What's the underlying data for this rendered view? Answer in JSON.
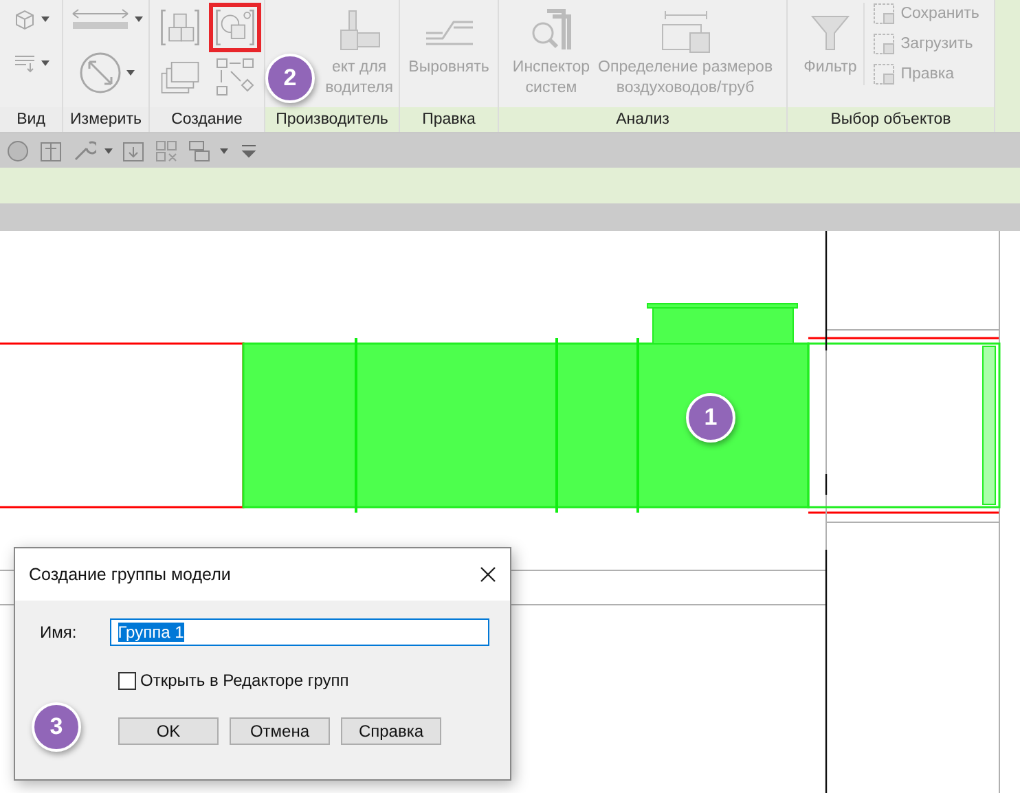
{
  "ribbon": {
    "panels": [
      {
        "label": "Вид",
        "kind": "standard",
        "buttons": [
          {
            "kind": "icon",
            "dropdown": true,
            "highlighted": false
          },
          {
            "kind": "icon",
            "dropdown": true,
            "highlighted": false
          }
        ]
      },
      {
        "label": "Измерить",
        "kind": "standard",
        "buttons": [
          {
            "kind": "icon",
            "dropdown": true,
            "highlighted": false
          },
          {
            "kind": "icon",
            "dropdown": true,
            "highlighted": false
          }
        ]
      },
      {
        "label": "Создание",
        "kind": "standard",
        "buttons": [
          {
            "kind": "icon",
            "dropdown": false,
            "highlighted": false
          },
          {
            "kind": "icon",
            "dropdown": false,
            "highlighted": true
          },
          {
            "kind": "icon",
            "dropdown": false,
            "highlighted": false
          },
          {
            "kind": "icon",
            "dropdown": false,
            "highlighted": false
          }
        ]
      },
      {
        "label": "Производитель",
        "kind": "contextual",
        "buttons": [
          {
            "kind": "large",
            "lines": [
              "ект для",
              "водителя"
            ],
            "disabled": true
          }
        ]
      },
      {
        "label": "Правка",
        "kind": "contextual",
        "buttons": [
          {
            "kind": "large",
            "lines": [
              "Выровнять"
            ],
            "disabled": true
          }
        ]
      },
      {
        "label": "Анализ",
        "kind": "contextual",
        "buttons": [
          {
            "kind": "large",
            "lines": [
              "Инспектор",
              "систем"
            ],
            "disabled": true
          },
          {
            "kind": "large",
            "lines": [
              "Определение размеров",
              "воздуховодов/труб"
            ],
            "disabled": true
          }
        ]
      },
      {
        "label": "Выбор объектов",
        "kind": "contextual",
        "buttons": [
          {
            "kind": "large",
            "lines": [
              "Фильтр"
            ],
            "disabled": true
          },
          {
            "kind": "small",
            "lines": [
              "Сохранить"
            ],
            "disabled": true
          },
          {
            "kind": "small",
            "lines": [
              "Загрузить"
            ],
            "disabled": true
          },
          {
            "kind": "small",
            "lines": [
              "Правка"
            ],
            "disabled": true
          }
        ]
      }
    ]
  },
  "badges": [
    {
      "number": "1"
    },
    {
      "number": "2"
    },
    {
      "number": "3"
    }
  ],
  "dialog": {
    "title": "Создание группы модели",
    "name_label": "Имя:",
    "name_value": "Группа 1",
    "value_selected": true,
    "checkbox": {
      "label": "Открыть в Редакторе групп",
      "checked": false
    },
    "buttons": [
      "OK",
      "Отмена",
      "Справка"
    ]
  }
}
